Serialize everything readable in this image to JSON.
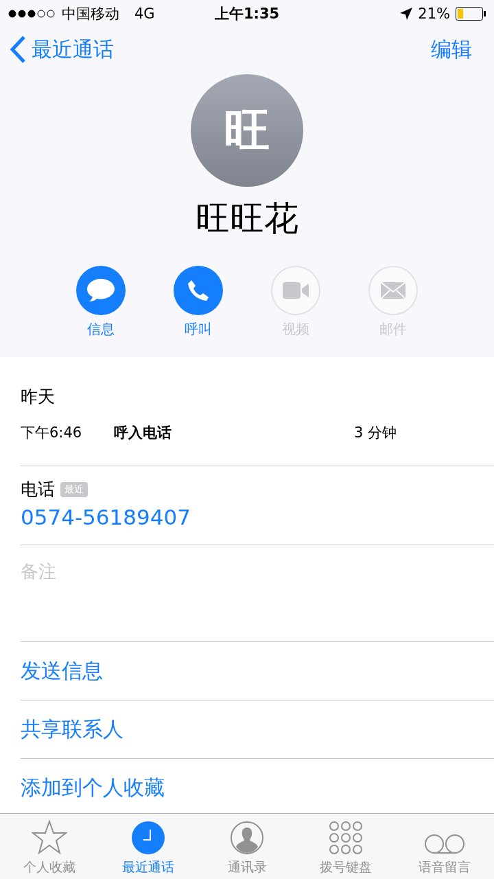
{
  "status_bar": {
    "carrier": "中国移动",
    "network": "4G",
    "time": "上午1:35",
    "battery": "21%"
  },
  "nav": {
    "back": "最近通话",
    "action": "编辑"
  },
  "contact": {
    "initial": "旺",
    "name": "旺旺花"
  },
  "actions": [
    {
      "kind": "message",
      "label": "信息",
      "disabled": false
    },
    {
      "kind": "phone",
      "label": "呼叫",
      "disabled": false
    },
    {
      "kind": "video",
      "label": "视频",
      "disabled": true
    },
    {
      "kind": "mail",
      "label": "邮件",
      "disabled": true
    }
  ],
  "recents": {
    "day": "昨天",
    "calls": [
      {
        "time": "下午6:46",
        "type": "呼入电话",
        "duration": "3 分钟"
      }
    ]
  },
  "phone": {
    "label": "电话",
    "badge": "最近",
    "number": "0574-56189407"
  },
  "notes": {
    "label": "备注"
  },
  "options": [
    "发送信息",
    "共享联系人",
    "添加到个人收藏"
  ],
  "tabs": [
    {
      "kind": "star",
      "label": "个人收藏",
      "selected": false
    },
    {
      "kind": "clock",
      "label": "最近通话",
      "selected": true
    },
    {
      "kind": "person",
      "label": "通讯录",
      "selected": false
    },
    {
      "kind": "keypad",
      "label": "拨号键盘",
      "selected": false
    },
    {
      "kind": "voicemail",
      "label": "语音留言",
      "selected": false
    }
  ]
}
